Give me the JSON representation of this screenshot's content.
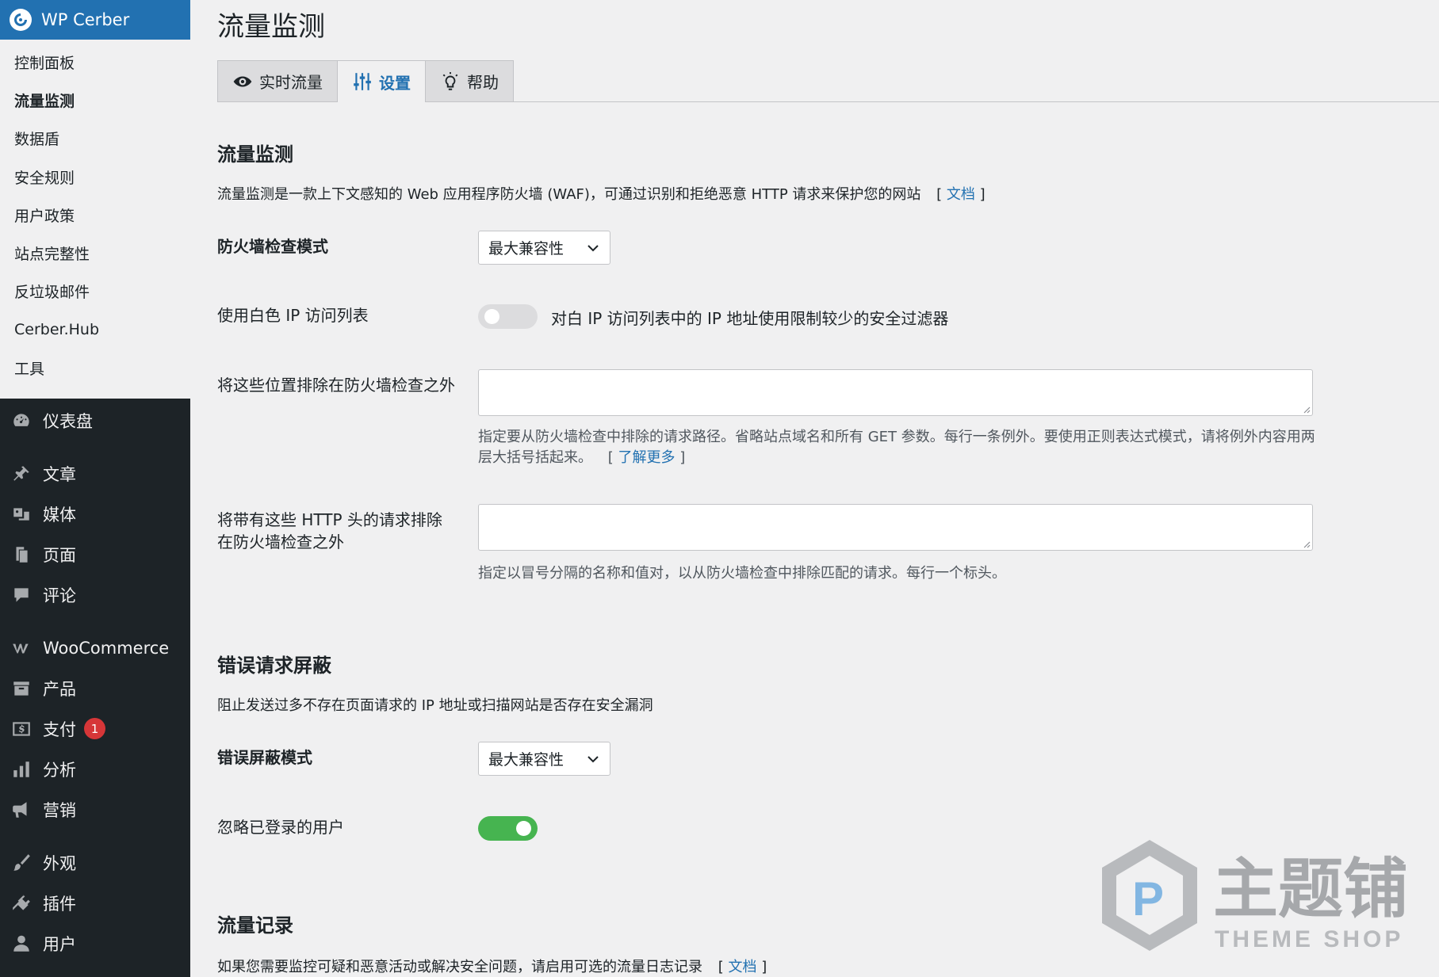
{
  "brand": {
    "title": "WP Cerber"
  },
  "submenu": [
    {
      "label": "控制面板",
      "current": false
    },
    {
      "label": "流量监测",
      "current": true
    },
    {
      "label": "数据盾",
      "current": false
    },
    {
      "label": "安全规则",
      "current": false
    },
    {
      "label": "用户政策",
      "current": false
    },
    {
      "label": "站点完整性",
      "current": false
    },
    {
      "label": "反垃圾邮件",
      "current": false
    },
    {
      "label": "Cerber.Hub",
      "current": false
    },
    {
      "label": "工具",
      "current": false
    }
  ],
  "menu": {
    "dashboard": {
      "label": "仪表盘",
      "icon": "dashboard-icon"
    },
    "posts": {
      "label": "文章",
      "icon": "pin-icon"
    },
    "media": {
      "label": "媒体",
      "icon": "media-icon"
    },
    "pages": {
      "label": "页面",
      "icon": "page-icon"
    },
    "comments": {
      "label": "评论",
      "icon": "comment-icon"
    },
    "woocommerce": {
      "label": "WooCommerce",
      "icon": "woo-icon"
    },
    "products": {
      "label": "产品",
      "icon": "archive-icon"
    },
    "payments": {
      "label": "支付",
      "icon": "dollar-icon",
      "badge": "1"
    },
    "analytics": {
      "label": "分析",
      "icon": "bar-chart-icon"
    },
    "marketing": {
      "label": "营销",
      "icon": "megaphone-icon"
    },
    "appearance": {
      "label": "外观",
      "icon": "brush-icon"
    },
    "plugins": {
      "label": "插件",
      "icon": "plugin-icon"
    },
    "users": {
      "label": "用户",
      "icon": "user-icon"
    }
  },
  "page": {
    "title": "流量监测",
    "tabs": [
      {
        "label": "实时流量",
        "icon": "eye-icon",
        "active": false
      },
      {
        "label": "设置",
        "icon": "sliders-icon",
        "active": true
      },
      {
        "label": "帮助",
        "icon": "lightbulb-icon",
        "active": false
      }
    ]
  },
  "waf": {
    "title": "流量监测",
    "desc": "流量监测是一款上下文感知的 Web 应用程序防火墙 (WAF)，可通过识别和拒绝恶意 HTTP 请求来保护您的网站",
    "doc_link": "文档",
    "mode_label": "防火墙检查模式",
    "mode_value": "最大兼容性",
    "whitelist_label": "使用白色 IP 访问列表",
    "whitelist_text": "对白 IP 访问列表中的 IP 地址使用限制较少的安全过滤器",
    "whitelist_on": false,
    "exclude_label": "将这些位置排除在防火墙检查之外",
    "exclude_help": "指定要从防火墙检查中排除的请求路径。省略站点域名和所有 GET 参数。每行一条例外。要使用正则表达式模式，请将例外内容用两层大括号括起来。",
    "exclude_link": "了解更多",
    "headers_label": "将带有这些 HTTP 头的请求排除在防火墙检查之外",
    "headers_help": "指定以冒号分隔的名称和值对，以从防火墙检查中排除匹配的请求。每行一个标头。"
  },
  "errors": {
    "title": "错误请求屏蔽",
    "desc": "阻止发送过多不存在页面请求的 IP 地址或扫描网站是否存在安全漏洞",
    "mode_label": "错误屏蔽模式",
    "mode_value": "最大兼容性",
    "ignore_label": "忽略已登录的用户",
    "ignore_on": true
  },
  "logging": {
    "title": "流量记录",
    "desc": "如果您需要监控可疑和恶意活动或解决安全问题，请启用可选的流量日志记录",
    "doc_link": "文档"
  },
  "watermark": {
    "text": "主题铺",
    "sub": "THEME SHOP"
  },
  "colors": {
    "accent": "#2271b1",
    "sidebar": "#1d2327",
    "toggle_on": "#46b450",
    "badge": "#d63638"
  }
}
